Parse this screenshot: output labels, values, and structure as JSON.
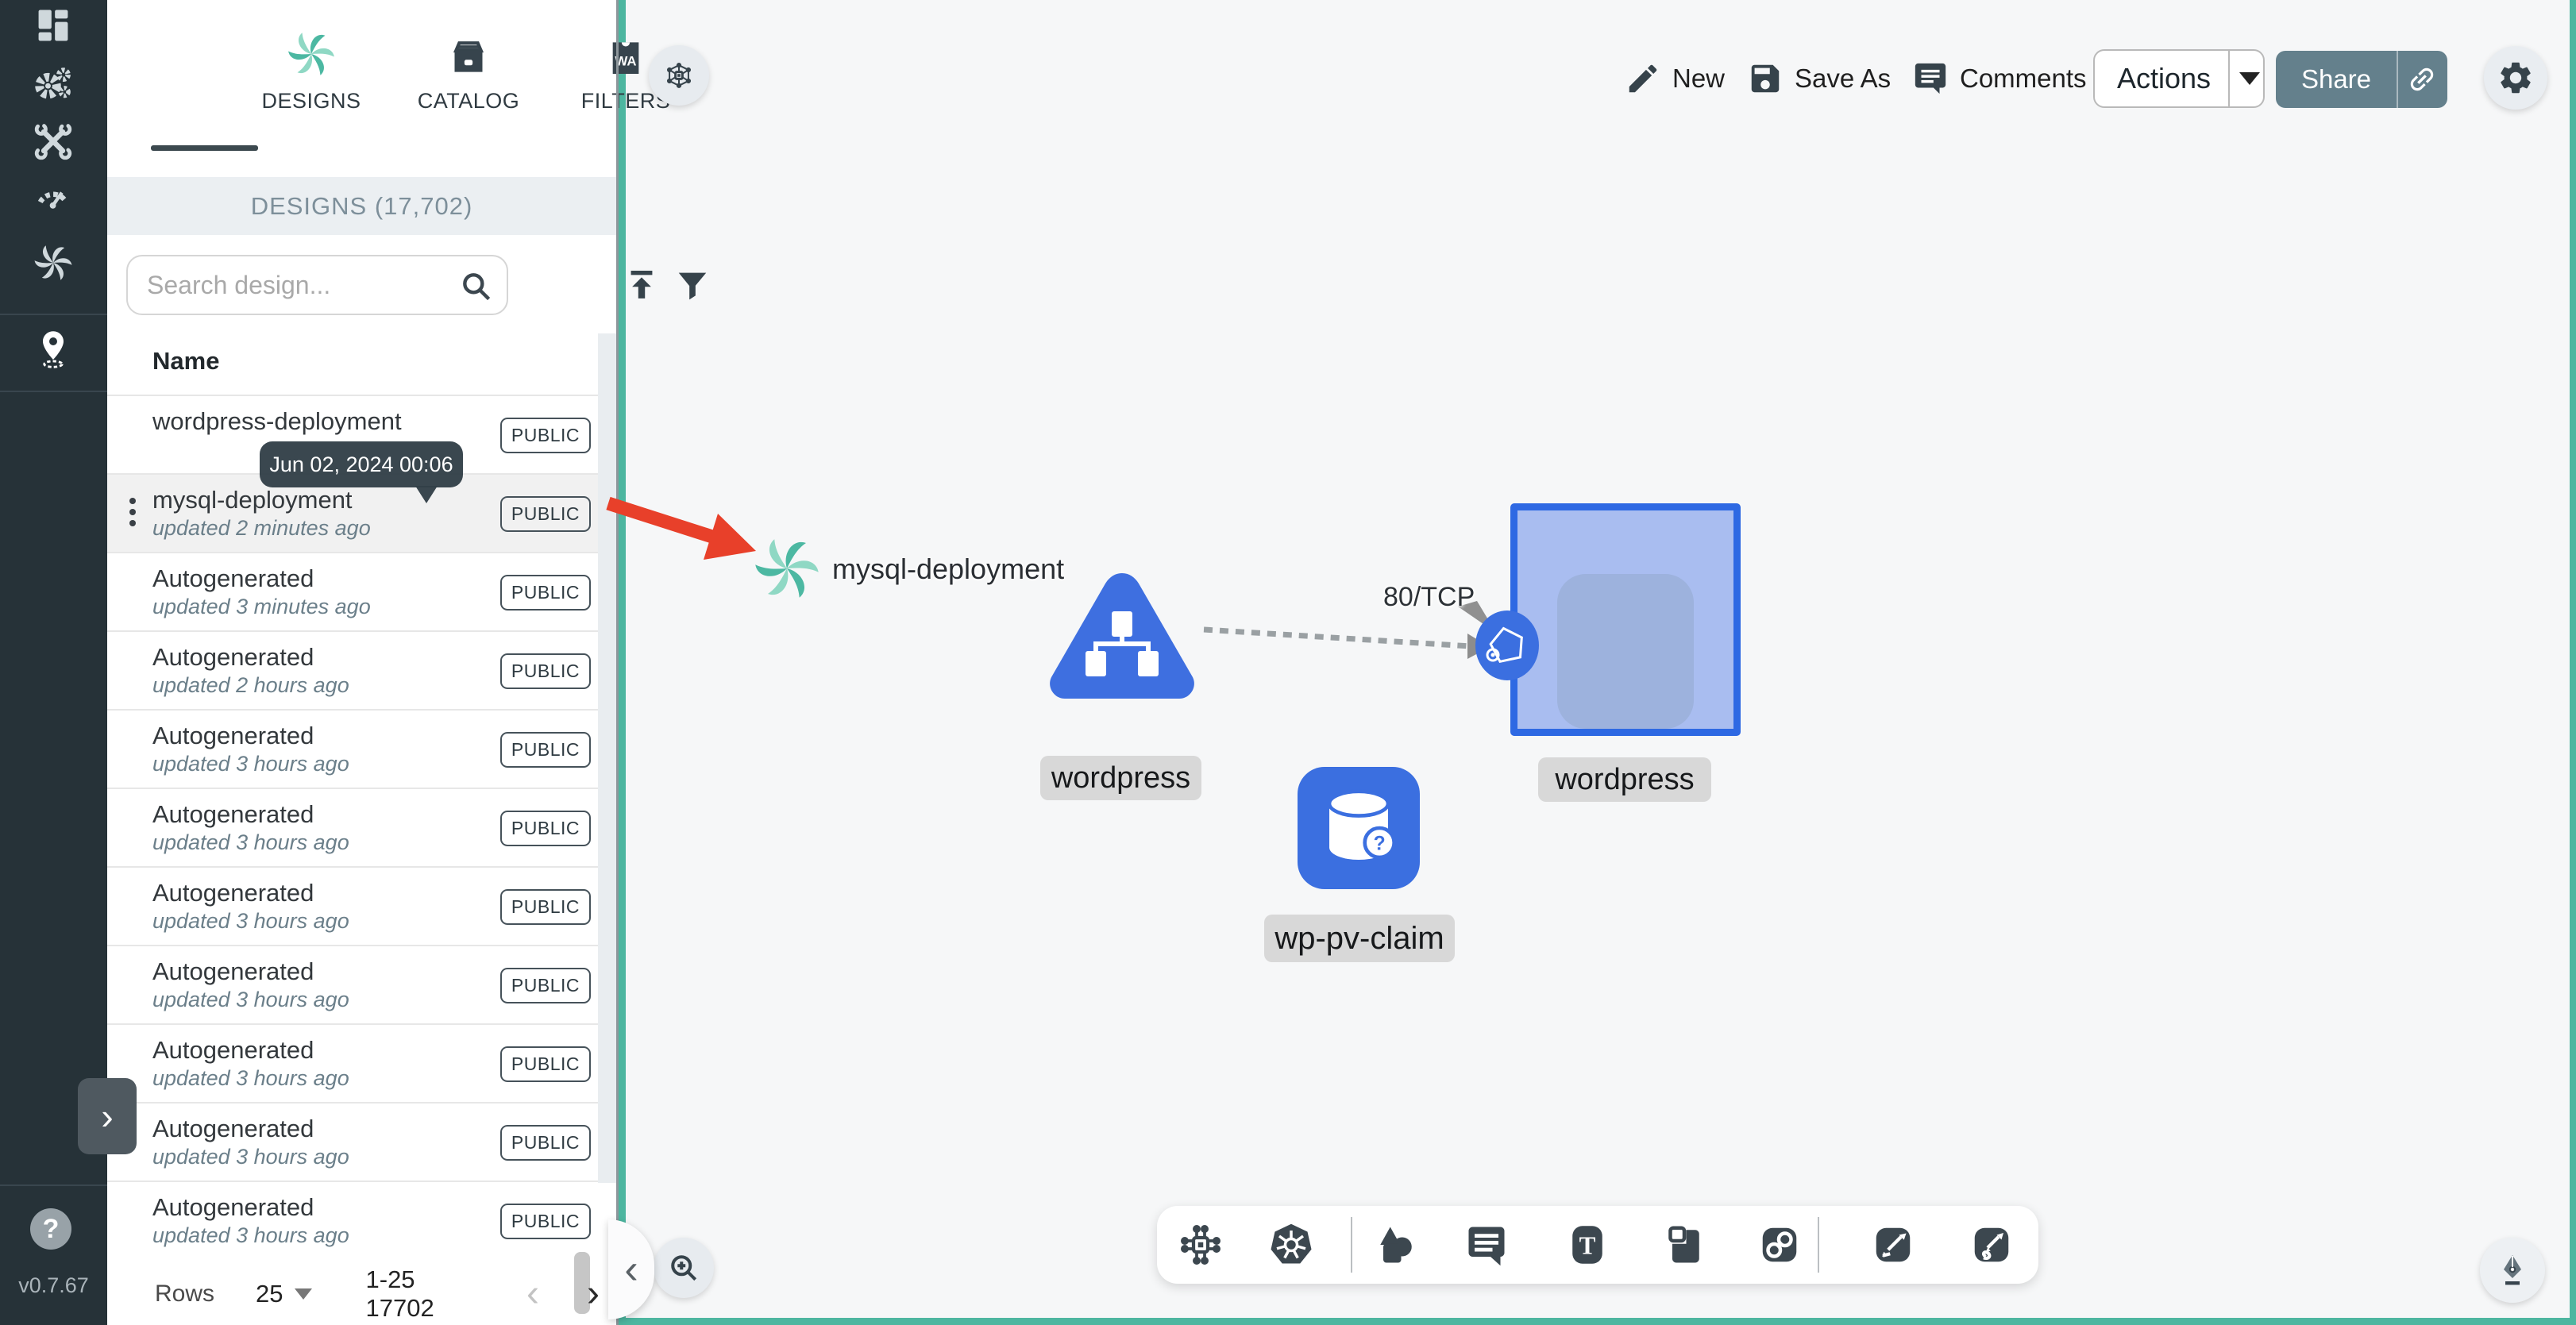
{
  "app": {
    "version": "v0.7.67"
  },
  "sidebar": {
    "items": [
      {
        "name": "dashboard"
      },
      {
        "name": "lifecycle"
      },
      {
        "name": "configuration"
      },
      {
        "name": "performance"
      },
      {
        "name": "extensions"
      },
      {
        "name": "kanvas"
      }
    ],
    "help": "?"
  },
  "panel": {
    "tabs": [
      {
        "label": "DESIGNS",
        "active": true
      },
      {
        "label": "CATALOG",
        "active": false
      },
      {
        "label": "FILTERS",
        "active": false,
        "badge": "WA"
      }
    ],
    "header": "DESIGNS (17,702)",
    "search": {
      "placeholder": "Search design..."
    },
    "table": {
      "name_column": "Name"
    },
    "tooltip": "Jun 02, 2024 00:06",
    "rows": [
      {
        "name": "wordpress-deployment",
        "updated": "",
        "visibility": "PUBLIC"
      },
      {
        "name": "mysql-deployment",
        "updated": "updated 2 minutes ago",
        "visibility": "PUBLIC"
      },
      {
        "name": "Autogenerated",
        "updated": "updated 3 minutes ago",
        "visibility": "PUBLIC"
      },
      {
        "name": "Autogenerated",
        "updated": "updated 2 hours ago",
        "visibility": "PUBLIC"
      },
      {
        "name": "Autogenerated",
        "updated": "updated 3 hours ago",
        "visibility": "PUBLIC"
      },
      {
        "name": "Autogenerated",
        "updated": "updated 3 hours ago",
        "visibility": "PUBLIC"
      },
      {
        "name": "Autogenerated",
        "updated": "updated 3 hours ago",
        "visibility": "PUBLIC"
      },
      {
        "name": "Autogenerated",
        "updated": "updated 3 hours ago",
        "visibility": "PUBLIC"
      },
      {
        "name": "Autogenerated",
        "updated": "updated 3 hours ago",
        "visibility": "PUBLIC"
      },
      {
        "name": "Autogenerated",
        "updated": "updated 3 hours ago",
        "visibility": "PUBLIC"
      },
      {
        "name": "Autogenerated",
        "updated": "updated 3 hours ago",
        "visibility": "PUBLIC"
      }
    ],
    "pagination": {
      "rows_label": "Rows",
      "page_size": "25",
      "range": "1-25 17702",
      "prev": "‹",
      "next": "›"
    }
  },
  "toolbar": {
    "new_label": "New",
    "save_as_label": "Save As",
    "comments_label": "Comments",
    "actions_label": "Actions",
    "share_label": "Share"
  },
  "canvas": {
    "nodes": {
      "mysql": {
        "label": "mysql-deployment"
      },
      "wordpress_service": {
        "label": "wordpress"
      },
      "wordpress_deployment": {
        "label": "wordpress"
      },
      "wp_pv_claim": {
        "label": "wp-pv-claim",
        "badge": "?"
      }
    },
    "edge": {
      "label": "80/TCP"
    },
    "text_tool_glyph": "T"
  },
  "colors": {
    "sidebar_bg": "#263238",
    "teal_border": "#4db6a0",
    "node_blue": "#3b6fe0",
    "selection_blue": "#2e69e3",
    "share_button": "#64808c",
    "red_arrow": "#e8402a",
    "meshery_green": "#4cb8a2"
  }
}
